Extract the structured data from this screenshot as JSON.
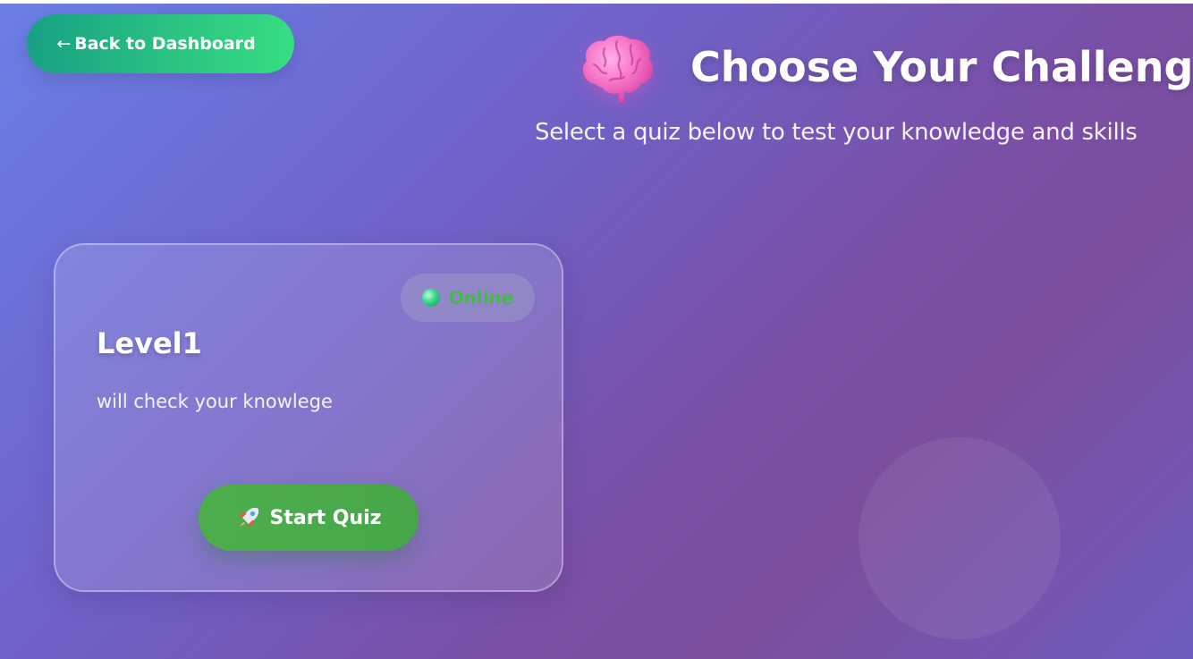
{
  "nav": {
    "back_arrow": "←",
    "back_label": "Back to Dashboard"
  },
  "header": {
    "icon": "brain-icon",
    "title": "Choose Your Challenge",
    "subtitle": "Select a quiz below to test your knowledge and skills"
  },
  "quizzes": [
    {
      "status": "Online",
      "status_icon": "green-dot-icon",
      "status_color": "#45b84b",
      "title": "Level1",
      "description": "will check your knowlege",
      "start_icon": "rocket-icon",
      "start_label": "Start Quiz"
    }
  ],
  "colors": {
    "back_button": "#2bc381",
    "start_button": "#4cae4c",
    "background_start": "#6a7fe6",
    "background_mid": "#7a4fa6"
  }
}
